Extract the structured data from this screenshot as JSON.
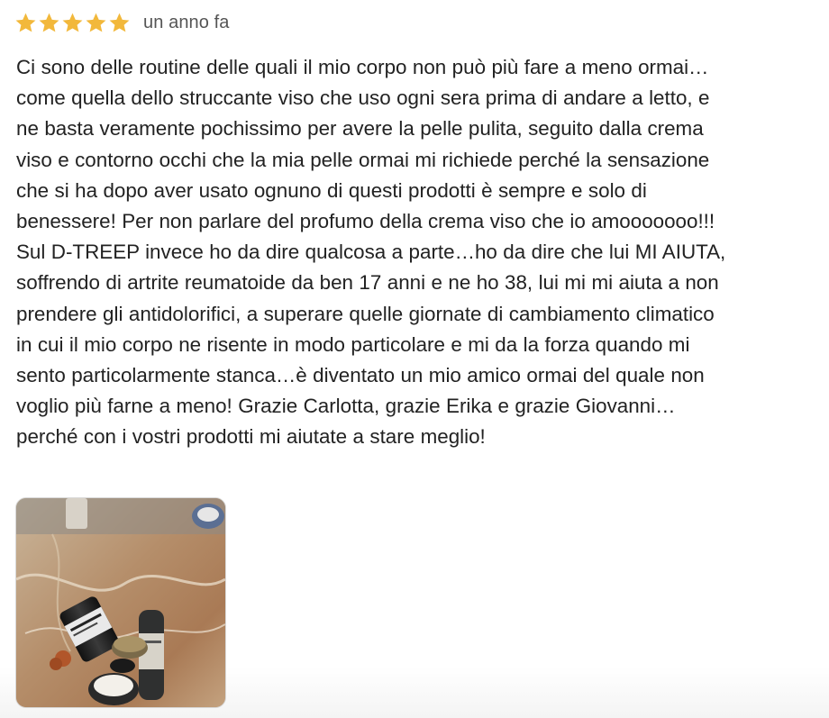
{
  "review": {
    "rating": 5,
    "rating_max": 5,
    "star_color": "#f2b83b",
    "date": "un anno fa",
    "body_lines": [
      "Ci sono delle routine delle quali il mio corpo non può più fare a meno ormai…",
      "come quella dello struccante viso che uso ogni sera prima di andare a letto, e",
      "ne basta veramente pochissimo per avere la pelle pulita, seguito dalla crema",
      "viso e contorno occhi che la mia pelle ormai mi richiede perché la sensazione",
      "che si ha dopo aver usato ognuno di questi prodotti è sempre e solo di",
      "benessere! Per non parlare del profumo della crema viso che io amooooooo!!!",
      "Sul D-TREEP invece ho da dire qualcosa a parte…ho da dire che lui MI AIUTA,",
      "soffrendo di artrite reumatoide da ben 17 anni e ne ho 38, lui mi mi aiuta a non",
      "prendere gli antidolorifici, a superare quelle giornate di cambiamento climatico",
      "in cui il mio corpo ne risente in modo particolare e mi da la forza quando mi",
      "sento particolarmente stanca…è diventato un mio amico ormai del quale non",
      "voglio più farne a meno! Grazie Carlotta, grazie Erika e grazie Giovanni…",
      "perché con i vostri prodotti mi aiutate a stare meglio!"
    ],
    "photo": {
      "icon": "product-photo"
    }
  }
}
